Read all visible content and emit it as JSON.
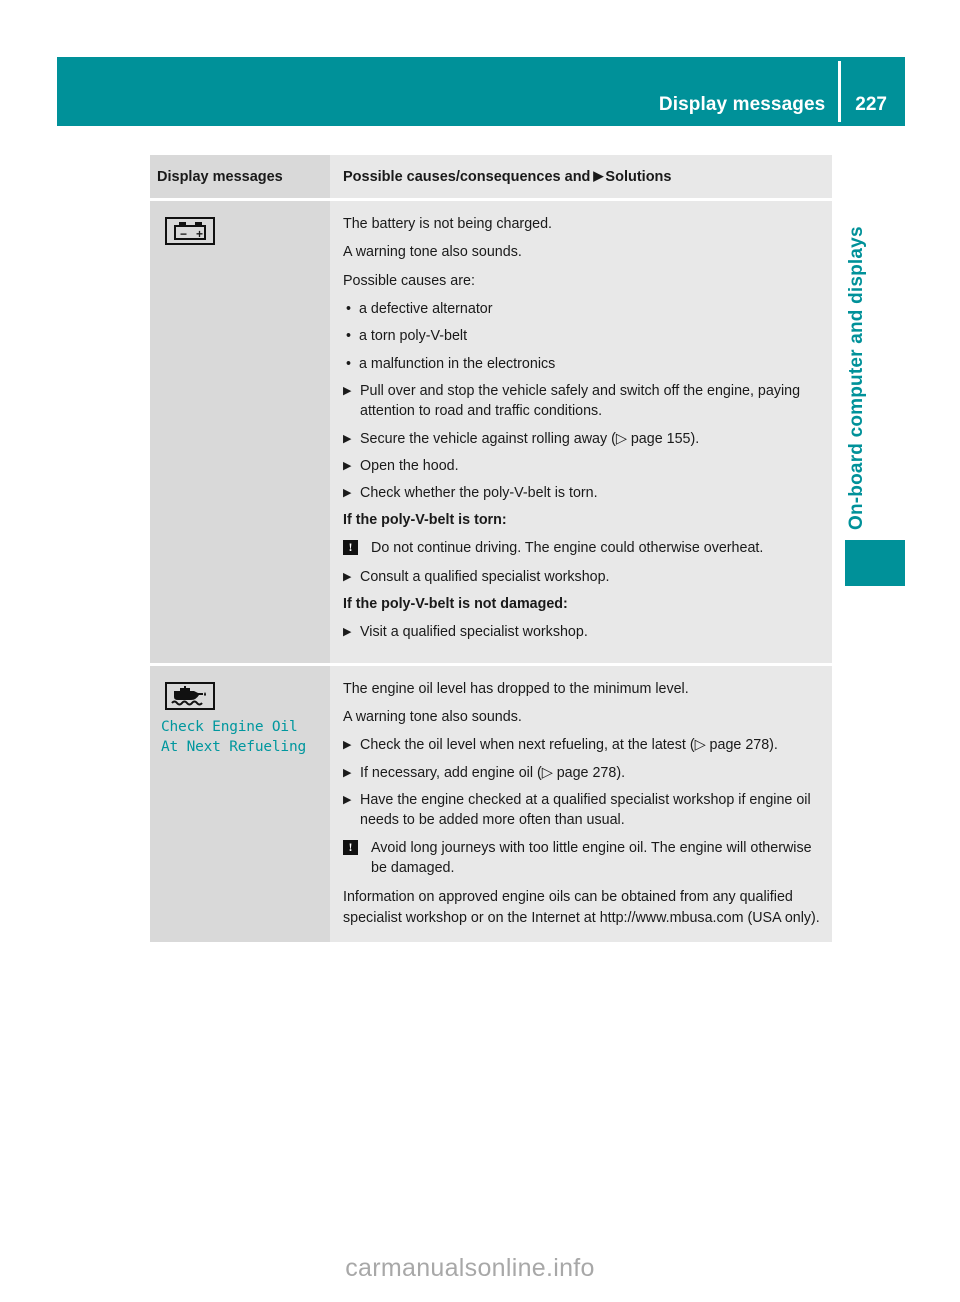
{
  "header": {
    "title": "Display messages",
    "page_number": "227"
  },
  "side_tab": {
    "label": "On-board computer and displays",
    "color": "#009199"
  },
  "table": {
    "columns": {
      "left": "Display messages",
      "right_prefix": "Possible causes/consequences and",
      "right_triangle": "▶",
      "right_suffix": "Solutions"
    },
    "rows": [
      {
        "icon": "battery-icon",
        "message": "",
        "blocks": [
          {
            "kind": "p",
            "text": "The battery is not being charged."
          },
          {
            "kind": "p",
            "text": "A warning tone also sounds."
          },
          {
            "kind": "p",
            "text": "Possible causes are:"
          },
          {
            "kind": "dot",
            "text": "a defective alternator"
          },
          {
            "kind": "dot",
            "text": "a torn poly-V-belt"
          },
          {
            "kind": "dot",
            "text": "a malfunction in the electronics"
          },
          {
            "kind": "x",
            "text": "Pull over and stop the vehicle safely and switch off the engine, paying attention to road and traffic conditions."
          },
          {
            "kind": "x",
            "text": "Secure the vehicle against rolling away (▷ page 155)."
          },
          {
            "kind": "x",
            "text": "Open the hood."
          },
          {
            "kind": "x",
            "text": "Check whether the poly-V-belt is torn."
          },
          {
            "kind": "bold",
            "text": "If the poly-V-belt is torn:"
          },
          {
            "kind": "warn",
            "text": "Do not continue driving. The engine could otherwise overheat."
          },
          {
            "kind": "x",
            "text": "Consult a qualified specialist workshop."
          },
          {
            "kind": "bold",
            "text": "If the poly-V-belt is not damaged:"
          },
          {
            "kind": "x",
            "text": "Visit a qualified specialist workshop."
          }
        ]
      },
      {
        "icon": "engine-oil-icon",
        "message": "Check Engine Oil\nAt Next Refueling",
        "message_color": "#00979e",
        "blocks": [
          {
            "kind": "p",
            "text": "The engine oil level has dropped to the minimum level."
          },
          {
            "kind": "p",
            "text": "A warning tone also sounds."
          },
          {
            "kind": "x",
            "text": "Check the oil level when next refueling, at the latest (▷ page 278)."
          },
          {
            "kind": "x",
            "text": "If necessary, add engine oil (▷ page 278)."
          },
          {
            "kind": "x",
            "text": "Have the engine checked at a qualified specialist workshop if engine oil needs to be added more often than usual."
          },
          {
            "kind": "warn",
            "text": "Avoid long journeys with too little engine oil. The engine will otherwise be damaged."
          },
          {
            "kind": "p",
            "text": "Information on approved engine oils can be obtained from any qualified specialist workshop or on the Internet at http://www.mbusa.com (USA only)."
          }
        ]
      }
    ]
  },
  "warning_symbol": "!",
  "bullet_symbol": "•",
  "action_triangle": "▶",
  "watermark": "carmanualsonline.info"
}
